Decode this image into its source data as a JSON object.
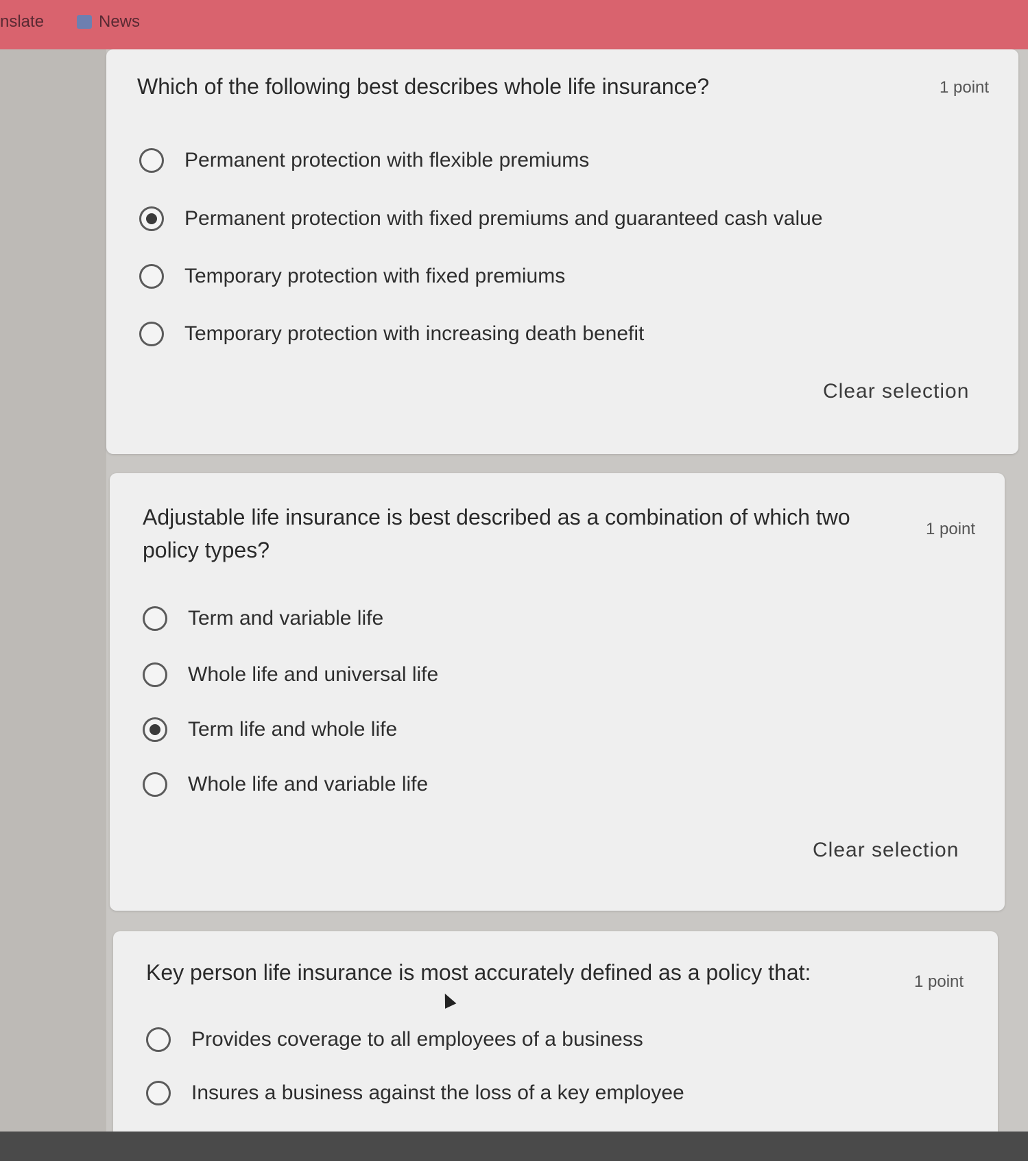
{
  "bookmarks": [
    {
      "label": "nslate",
      "icon": "none"
    },
    {
      "label": "News",
      "icon": "bookmark-folder-icon"
    }
  ],
  "questions": [
    {
      "title": "Which of the following best describes whole life insurance?",
      "points": "1 point",
      "options": [
        {
          "label": "Permanent protection with flexible premiums",
          "selected": false
        },
        {
          "label": "Permanent protection with fixed premiums and guaranteed cash value",
          "selected": true
        },
        {
          "label": "Temporary protection with fixed premiums",
          "selected": false
        },
        {
          "label": "Temporary protection with increasing death benefit",
          "selected": false
        }
      ],
      "clear_label": "Clear selection"
    },
    {
      "title_line1": "Adjustable life insurance is best described as a combination of which two",
      "title_line2": "policy types?",
      "points": "1 point",
      "options": [
        {
          "label": "Term and variable life",
          "selected": false
        },
        {
          "label": "Whole life and universal life",
          "selected": false
        },
        {
          "label": "Term life and whole life",
          "selected": true
        },
        {
          "label": "Whole life and variable life",
          "selected": false
        }
      ],
      "clear_label": "Clear selection"
    },
    {
      "title": "Key person life insurance is most accurately defined as a policy that:",
      "points": "1 point",
      "options": [
        {
          "label": "Provides coverage to all employees of a business",
          "selected": false
        },
        {
          "label": "Insures a business against the loss of a key employee",
          "selected": false
        }
      ]
    }
  ]
}
